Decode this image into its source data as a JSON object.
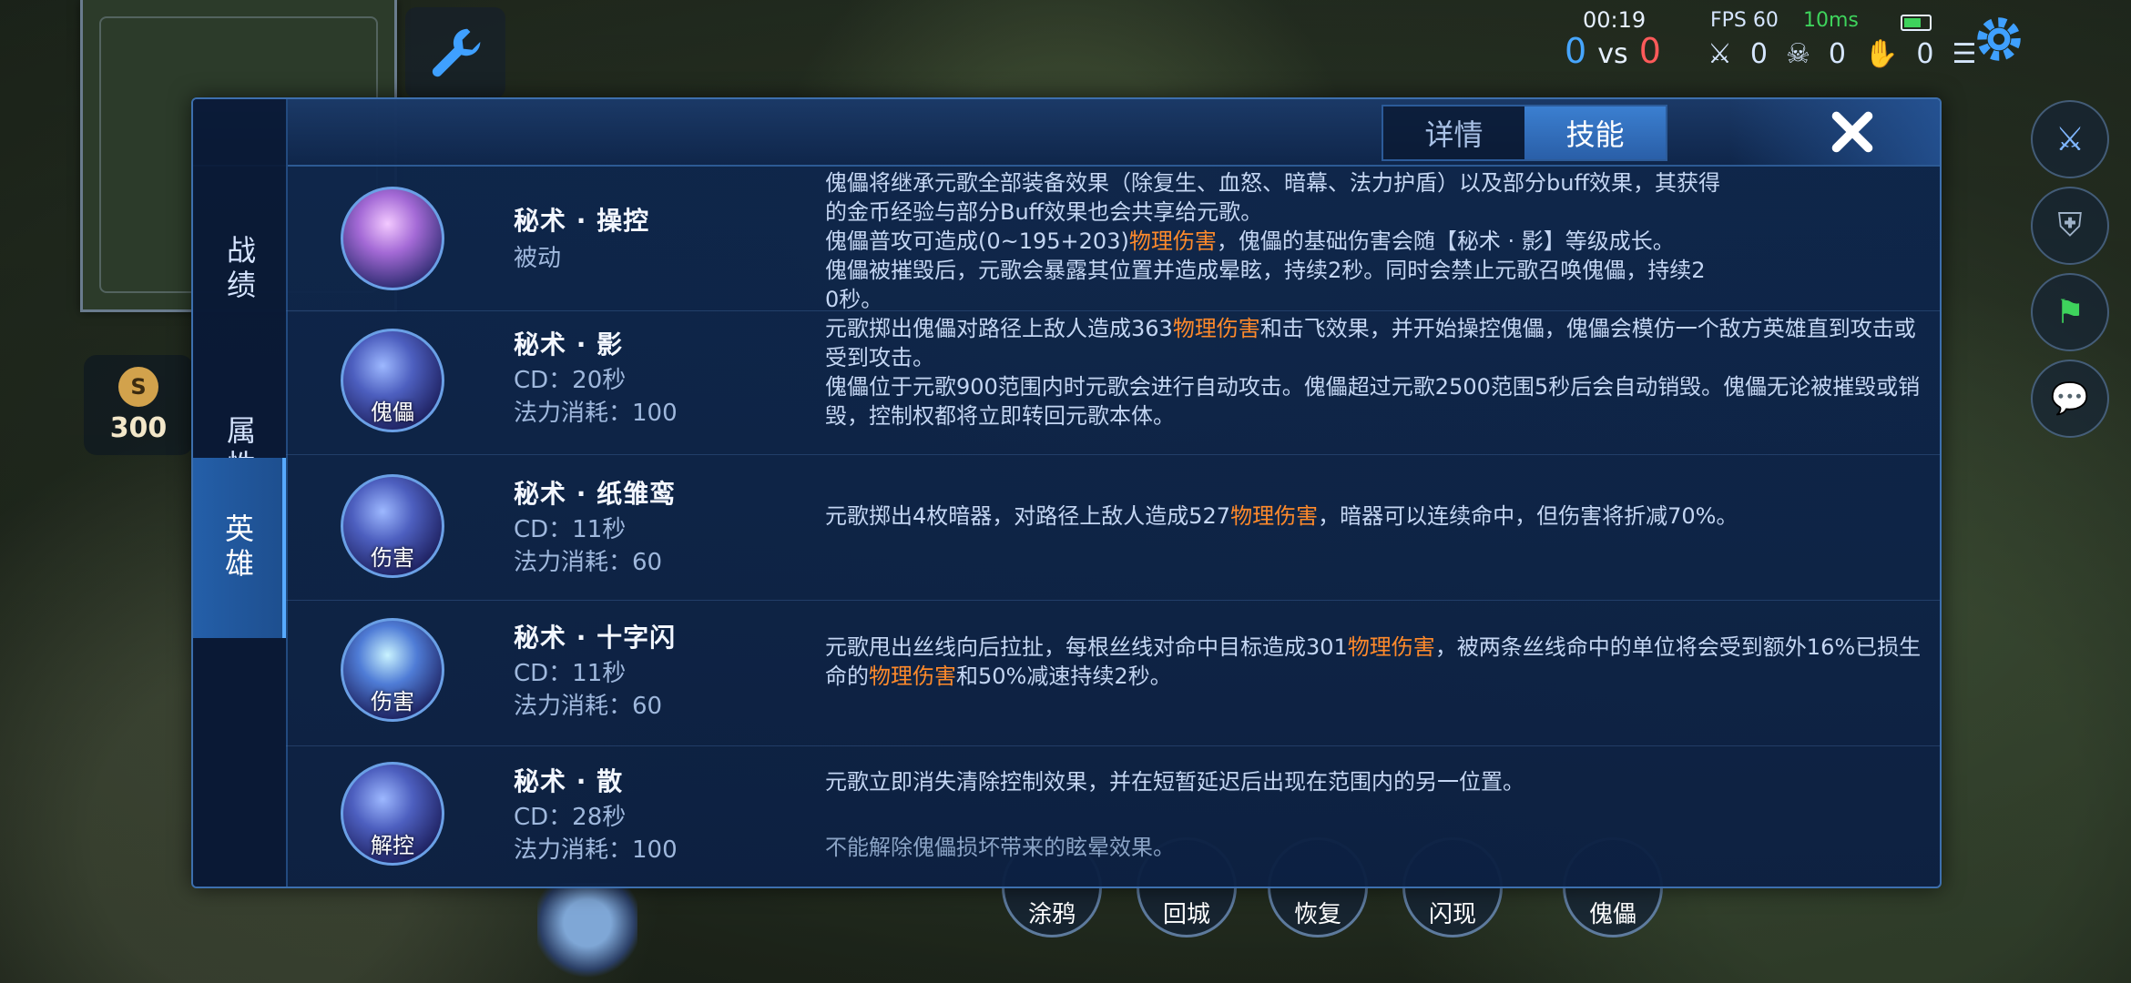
{
  "hud": {
    "time": "00:19",
    "score_blue": "0",
    "vs": "vs",
    "score_red": "0",
    "fps": "FPS 60",
    "ping": "10ms",
    "kills": "0",
    "deaths": "0",
    "assists": "0",
    "gold": "300",
    "gold_symbol": "S"
  },
  "tabs": [
    {
      "label": "详情",
      "active": false
    },
    {
      "label": "技能",
      "active": true
    }
  ],
  "side_nav": [
    {
      "label": "战绩",
      "active": false
    },
    {
      "label": "属性",
      "active": false
    },
    {
      "label": "英雄",
      "active": true
    }
  ],
  "skills": [
    {
      "name": "秘术 · 操控",
      "sub1": "被动",
      "sub2": "",
      "icon_tag": "",
      "desc_lines": [
        "傀儡将继承元歌全部装备效果（除复生、血怒、暗幕、法力护盾）以及部分buff效果，其获得",
        "的金币经验与部分Buff效果也会共享给元歌。",
        "傀儡普攻可造成(0~195+203)",
        "物理伤害",
        "，傀儡的基础伤害会随【秘术 · 影】等级成长。",
        "傀儡被摧毁后，元歌会暴露其位置并造成晕眩，持续2秒。同时会禁止元歌召唤傀儡，持续2",
        "0秒。"
      ]
    },
    {
      "name": "秘术 · 影",
      "sub1": "CD：20秒",
      "sub2": "法力消耗：100",
      "icon_tag": "傀儡",
      "desc_parts": [
        "元歌掷出傀儡对路径上敌人造成363",
        "物理伤害",
        "和击飞效果，并开始操控傀儡，傀儡会模仿一个敌方英雄直到攻击或受到攻击。",
        "傀儡位于元歌900范围内时元歌会进行自动攻击。傀儡超过元歌2500范围5秒后会自动销毁。傀儡无论被摧毁或销毁，控制权都将立即转回元歌本体。"
      ]
    },
    {
      "name": "秘术 · 纸雏鸾",
      "sub1": "CD：11秒",
      "sub2": "法力消耗：60",
      "icon_tag": "伤害",
      "desc_parts": [
        "元歌掷出4枚暗器，对路径上敌人造成527",
        "物理伤害",
        "，暗器可以连续命中，但伤害将折减70%。"
      ]
    },
    {
      "name": "秘术 · 十字闪",
      "sub1": "CD：11秒",
      "sub2": "法力消耗：60",
      "icon_tag": "伤害",
      "desc_parts": [
        "元歌甩出丝线向后拉扯，每根丝线对命中目标造成301",
        "物理伤害",
        "，被两条丝线命中的单位将会受到额外16%已损生命的",
        "物理伤害",
        "和50%减速持续2秒。"
      ]
    },
    {
      "name": "秘术 · 散",
      "sub1": "CD：28秒",
      "sub2": "法力消耗：100",
      "icon_tag": "解控",
      "desc_parts": [
        "元歌立即消失清除控制效果，并在短暂延迟后出现在范围内的另一位置。"
      ],
      "note": "不能解除傀儡损坏带来的眩晕效果。"
    }
  ],
  "bottom_skills": [
    "涂鸦",
    "回城",
    "恢复",
    "闪现",
    "傀儡"
  ],
  "colors": {
    "panel_bg": "#0e2a54",
    "highlight": "#ff8a2b",
    "tab_active": "#2f6fbf",
    "score_blue": "#47a6ff",
    "score_red": "#ff5a5a",
    "ping_green": "#3ed35c"
  }
}
